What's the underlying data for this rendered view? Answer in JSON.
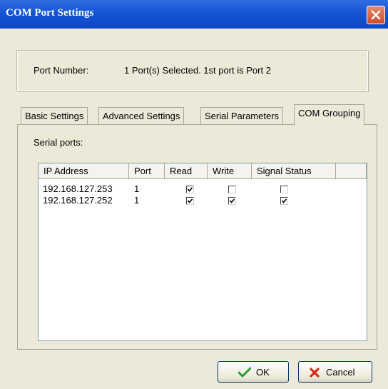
{
  "window": {
    "title": "COM Port Settings"
  },
  "port": {
    "label": "Port Number:",
    "value": "1 Port(s) Selected. 1st port is Port 2"
  },
  "tabs": [
    {
      "label": "Basic Settings"
    },
    {
      "label": "Advanced Settings"
    },
    {
      "label": "Serial Parameters"
    },
    {
      "label": "COM Grouping",
      "active": true
    }
  ],
  "serial_ports": {
    "label": "Serial ports:",
    "columns": [
      "IP Address",
      "Port",
      "Read",
      "Write",
      "Signal Status"
    ],
    "rows": [
      {
        "ip": "192.168.127.253",
        "port": "1",
        "read": true,
        "write": false,
        "signal": false
      },
      {
        "ip": "192.168.127.252",
        "port": "1",
        "read": true,
        "write": true,
        "signal": true
      }
    ]
  },
  "buttons": {
    "ok": "OK",
    "cancel": "Cancel"
  },
  "icons": {
    "close": "close-icon",
    "ok": "checkmark-icon",
    "cancel": "x-icon"
  },
  "colors": {
    "titlebar": "#0b48c4",
    "close": "#cf4d2d",
    "ok_icon": "#2e9b2e",
    "cancel_icon": "#d62b1b"
  }
}
